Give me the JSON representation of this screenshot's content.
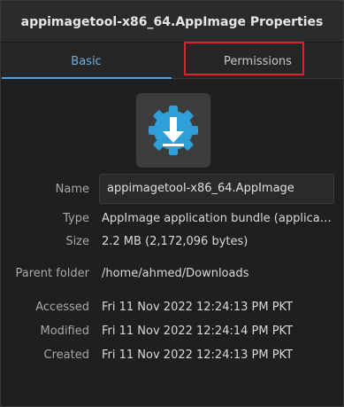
{
  "window": {
    "title": "appimagetool-x86_64.AppImage Properties"
  },
  "tabs": [
    {
      "label": "Basic",
      "active": true
    },
    {
      "label": "Permissions",
      "active": false
    }
  ],
  "file_icon": {
    "name": "download-gear-icon",
    "color": "#2e9fd9"
  },
  "fields": {
    "name": {
      "label": "Name",
      "value": "appimagetool-x86_64.AppImage"
    },
    "type": {
      "label": "Type",
      "value": "AppImage application bundle (applicatio..."
    },
    "size": {
      "label": "Size",
      "value": "2.2 MB (2,172,096 bytes)"
    },
    "parent": {
      "label": "Parent folder",
      "value": "/home/ahmed/Downloads"
    },
    "accessed": {
      "label": "Accessed",
      "value": "Fri 11 Nov 2022 12:24:13 PM PKT"
    },
    "modified": {
      "label": "Modified",
      "value": "Fri 11 Nov 2022 12:24:14 PM PKT"
    },
    "created": {
      "label": "Created",
      "value": "Fri 11 Nov 2022 12:24:13 PM PKT"
    }
  },
  "colors": {
    "accent": "#4aa3e6",
    "highlight": "#e0202b",
    "background": "#1f1f1f"
  }
}
